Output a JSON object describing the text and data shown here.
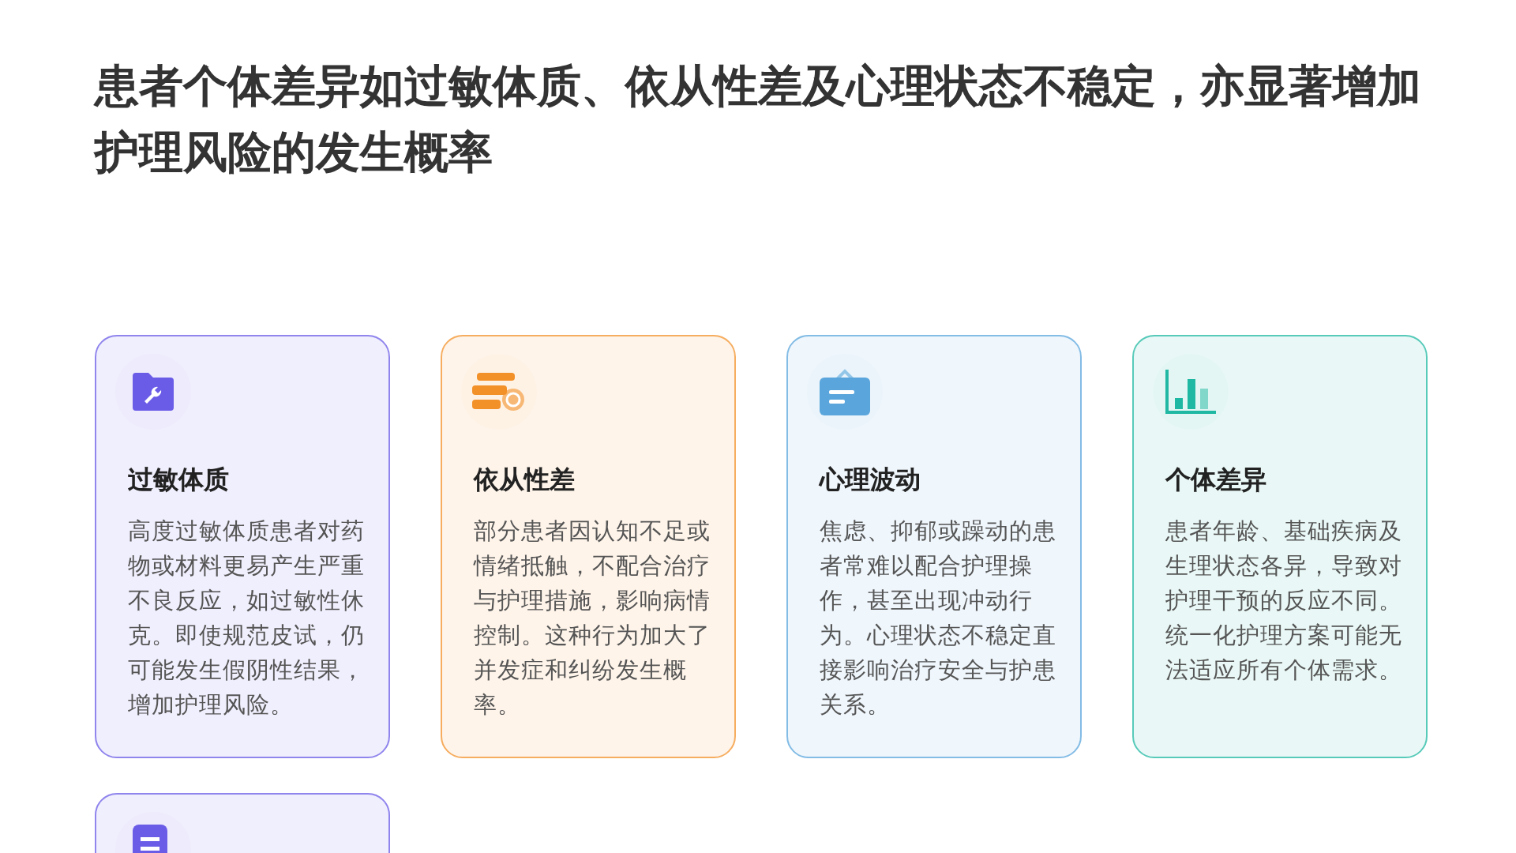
{
  "title": "患者个体差异如过敏体质、依从性差及心理状态不稳定，亦显著增加护理风险的发生概率",
  "cards": [
    {
      "kind": "folder",
      "color": "#6b5ce7",
      "heading": "过敏体质",
      "body": "高度过敏体质患者对药物或材料更易产生严重不良反应，如过敏性休克。即使规范皮试，仍可能发生假阴性结果，增加护理风险。"
    },
    {
      "kind": "stack",
      "color": "#f39129",
      "heading": "依从性差",
      "body": "部分患者因认知不足或情绪抵触，不配合治疗与护理措施，影响病情控制。这种行为加大了并发症和纠纷发生概率。"
    },
    {
      "kind": "bag",
      "color": "#5aa6dc",
      "heading": "心理波动",
      "body": "焦虑、抑郁或躁动的患者常难以配合护理操作，甚至出现冲动行为。心理状态不稳定直接影响治疗安全与护患关系。"
    },
    {
      "kind": "chart",
      "color": "#1fb8a2",
      "heading": "个体差异",
      "body": "患者年龄、基础疾病及生理状态各异，导致对护理干预的反应不同。统一化护理方案可能无法适应所有个体需求。"
    },
    {
      "kind": "document",
      "color": "#6b5ce7"
    }
  ]
}
